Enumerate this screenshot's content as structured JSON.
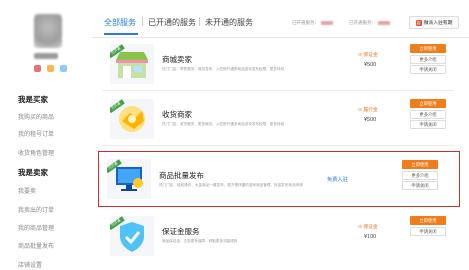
{
  "sidebar": {
    "section_buyer": "我是买家",
    "buyer_items": [
      "我购买的商品",
      "我的租号订单",
      "收货角色管理"
    ],
    "section_seller": "我是卖家",
    "seller_items": [
      "我要卖",
      "我卖出的订单",
      "我的商品管理",
      "商品批量发布",
      "店铺设置"
    ]
  },
  "tabs": [
    {
      "label": "全部服务",
      "active": true
    },
    {
      "label": "已开通的服务",
      "active": false
    },
    {
      "label": "未开通的服务",
      "active": false
    }
  ],
  "stats": {
    "opened_label": "已开通服务：",
    "unopened_label": "已开通服务："
  },
  "market_button": "微派入驻有期",
  "services": [
    {
      "title": "商城卖家",
      "status_ribbon": "已开通",
      "desc": "热门门店、寄售服务、商品发布、入驻即开通多商品游戏发布权限、更多特权",
      "deposit_label": "保证金",
      "price": "¥500",
      "buttons": [
        "立即使用",
        "更多介绍",
        "申请关闭"
      ],
      "accent": "#7cb342"
    },
    {
      "title": "收货商家",
      "status_ribbon": "已开通",
      "desc": "热门门店、收货服务、更多服务、入驻即开通多商品游戏发布权限、更多特权",
      "deposit_label": "履行金",
      "price": "¥500",
      "buttons": [
        "立即使用",
        "更多介绍",
        "申请关闭"
      ],
      "accent": "#f5a623"
    },
    {
      "title": "商品批量发布",
      "status_ribbon": "已开通",
      "desc": "热门门店、轻松操作、大量商品一键发布，更方便快捷的游戏商品管理，批量发布商品申请",
      "free_label": "免费入驻",
      "buttons": [
        "立即使用",
        "更多介绍",
        "申请关闭"
      ],
      "accent": "#1e88e5"
    },
    {
      "title": "保证金服务",
      "status_ribbon": "已开通",
      "desc": "商品保证金，交易更有保障，获取更多流量倾斜",
      "deposit_label": "保证金",
      "price": "¥100",
      "buttons": [
        "立即使用",
        "申请关闭"
      ],
      "accent": "#29b6f6"
    }
  ]
}
